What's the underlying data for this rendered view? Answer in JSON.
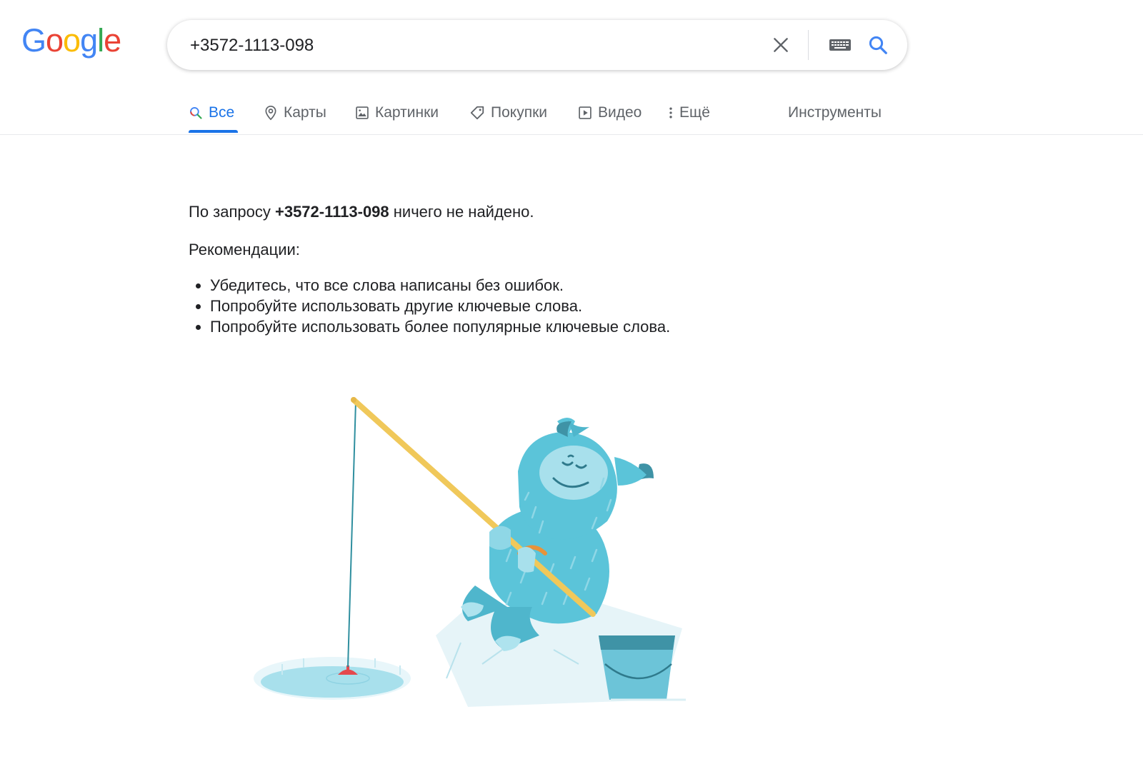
{
  "logo": {
    "letters": [
      "G",
      "o",
      "o",
      "g",
      "l",
      "e"
    ],
    "colors": [
      "#4285F4",
      "#EA4335",
      "#FBBC05",
      "#4285F4",
      "#34A853",
      "#EA4335"
    ]
  },
  "search": {
    "query": "+3572-1113-098",
    "clear_icon": "close-icon",
    "keyboard_icon": "keyboard-icon",
    "search_icon": "search-icon"
  },
  "tabs": [
    {
      "label": "Все",
      "icon": "search-icon",
      "active": true
    },
    {
      "label": "Карты",
      "icon": "map-pin-icon",
      "active": false
    },
    {
      "label": "Картинки",
      "icon": "image-icon",
      "active": false
    },
    {
      "label": "Покупки",
      "icon": "tag-icon",
      "active": false
    },
    {
      "label": "Видео",
      "icon": "play-icon",
      "active": false
    },
    {
      "label": "Ещё",
      "icon": "more-vert-icon",
      "active": false
    }
  ],
  "tools_label": "Инструменты",
  "results": {
    "prefix": "По запросу ",
    "query": "+3572-1113-098",
    "suffix": " ничего не найдено.",
    "recommendations_title": "Рекомендации:",
    "recommendations": [
      "Убедитесь, что все слова написаны без ошибок.",
      "Попробуйте использовать другие ключевые слова.",
      "Попробуйте использовать более популярные ключевые слова."
    ]
  },
  "colors": {
    "accent": "#1a73e8",
    "tab_text": "#5f6368",
    "text": "#202124"
  }
}
